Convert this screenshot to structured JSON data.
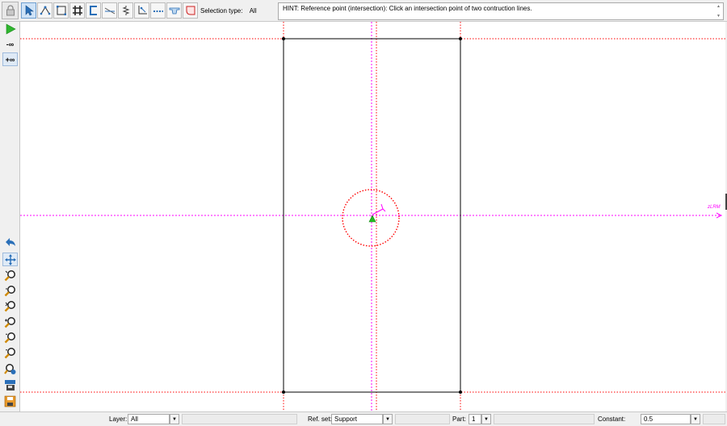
{
  "toolbar": {
    "selection_type_label": "Selection type:",
    "selection_type_value": "All",
    "tools": [
      "select-arrow-icon",
      "node-select-icon",
      "rectangle-select-icon",
      "grid-snap-icon",
      "channel-section-icon",
      "construction-line-icon",
      "spring-icon",
      "corner-select-icon",
      "dashed-line-icon",
      "beam-section-icon",
      "rounded-corner-icon"
    ]
  },
  "hint": {
    "text": "HINT: Reference point (intersection): Click an intersection point of two contruction lines."
  },
  "left_toolbar": {
    "minus_inf": "-∞",
    "plus_inf": "+∞"
  },
  "canvas": {
    "axis_label": "zLRM"
  },
  "status": {
    "layer_label": "Layer:",
    "layer_value": "All",
    "refset_label": "Ref. set:",
    "refset_value": "Support",
    "part_label": "Part:",
    "part_value": "1",
    "constant_label": "Constant:",
    "constant_value": "0.5"
  },
  "colors": {
    "construction_line": "#ff0000",
    "axis_line": "#ff00ff",
    "outline": "#000000",
    "point_marker": "#22bb22"
  }
}
